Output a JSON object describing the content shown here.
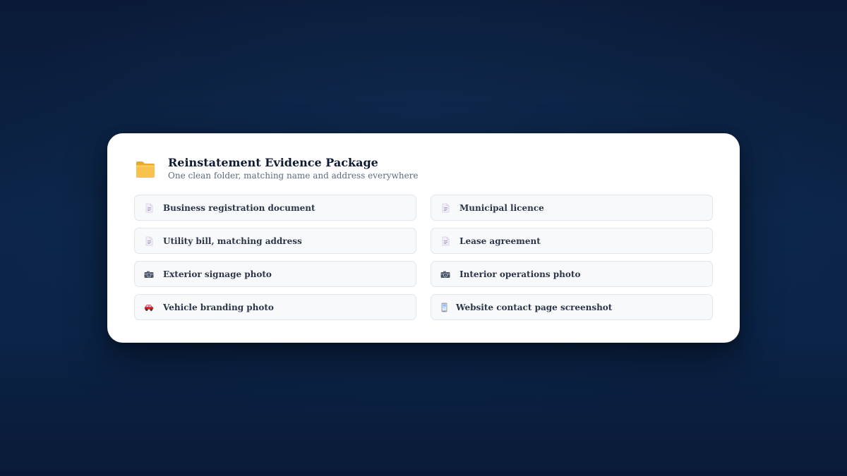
{
  "package": {
    "title": "Reinstatement Evidence Package",
    "subtitle": "One clean folder, matching name and address everywhere",
    "icon": "folder-icon"
  },
  "items": [
    {
      "label": "Business registration document",
      "icon": "document-icon"
    },
    {
      "label": "Municipal licence",
      "icon": "document-icon"
    },
    {
      "label": "Utility bill, matching address",
      "icon": "document-icon"
    },
    {
      "label": "Lease agreement",
      "icon": "document-icon"
    },
    {
      "label": "Exterior signage photo",
      "icon": "camera-icon"
    },
    {
      "label": "Interior operations photo",
      "icon": "camera-icon"
    },
    {
      "label": "Vehicle branding photo",
      "icon": "car-icon"
    },
    {
      "label": "Website contact page screenshot",
      "icon": "phone-icon"
    }
  ],
  "colors": {
    "card_bg": "#ffffff",
    "item_bg": "#f7f9fb",
    "title": "#0f1b33",
    "folder": "#f7c04a"
  }
}
